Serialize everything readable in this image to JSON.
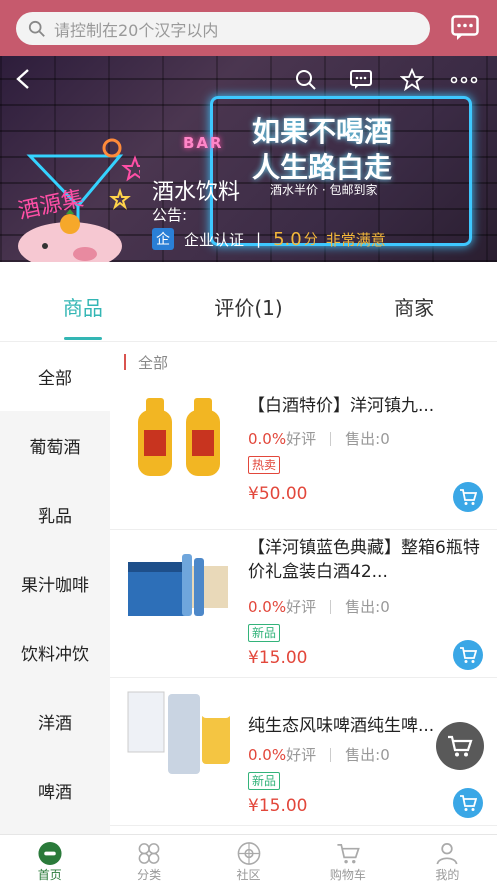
{
  "search": {
    "placeholder": "请控制在20个汉字以内"
  },
  "banner": {
    "bar_sign": "BAR",
    "slogan_line1": "如果不喝酒",
    "slogan_line2": "人生路白走",
    "shop_name": "酒水饮料",
    "shop_subtitle": "酒水半价 · 包邮到家",
    "notice_label": "公告:",
    "cert_badge": "企",
    "cert_label": "企业认证",
    "cert_separator": "|",
    "score": "5.0",
    "score_unit": "分",
    "satisfaction": "非常满意"
  },
  "tabs": [
    {
      "label": "商品",
      "active": true
    },
    {
      "label": "评价(1)",
      "active": false
    },
    {
      "label": "商家",
      "active": false
    }
  ],
  "sidebar": {
    "items": [
      {
        "label": "全部",
        "active": true
      },
      {
        "label": "葡萄酒",
        "active": false
      },
      {
        "label": "乳品",
        "active": false
      },
      {
        "label": "果汁咖啡",
        "active": false
      },
      {
        "label": "饮料冲饮",
        "active": false
      },
      {
        "label": "洋酒",
        "active": false
      },
      {
        "label": "啤酒",
        "active": false
      }
    ]
  },
  "list": {
    "category_title": "全部",
    "items": [
      {
        "title": "【白酒特价】洋河镇九...",
        "rating": "0.0%",
        "rating_label": "好评",
        "sold_label": "售出:",
        "sold": "0",
        "tag": "热卖",
        "price": "¥50.00"
      },
      {
        "title": "【洋河镇蓝色典藏】整箱6瓶特价礼盒装白酒42...",
        "rating": "0.0%",
        "rating_label": "好评",
        "sold_label": "售出:",
        "sold": "0",
        "tag": "新品",
        "price": "¥15.00"
      },
      {
        "title": "纯生态风味啤酒纯生啤...",
        "rating": "0.0%",
        "rating_label": "好评",
        "sold_label": "售出:",
        "sold": "0",
        "tag": "新品",
        "price": "¥15.00"
      }
    ]
  },
  "bottom_nav": [
    {
      "label": "首页",
      "icon": "home-icon",
      "active": true
    },
    {
      "label": "分类",
      "icon": "category-icon",
      "active": false
    },
    {
      "label": "社区",
      "icon": "community-icon",
      "active": false
    },
    {
      "label": "购物车",
      "icon": "cart-icon",
      "active": false
    },
    {
      "label": "我的",
      "icon": "profile-icon",
      "active": false
    }
  ],
  "colors": {
    "header": "#c65a6d",
    "accent": "#33b6b4",
    "price": "#e2473b",
    "cart": "#3aa7e6"
  }
}
